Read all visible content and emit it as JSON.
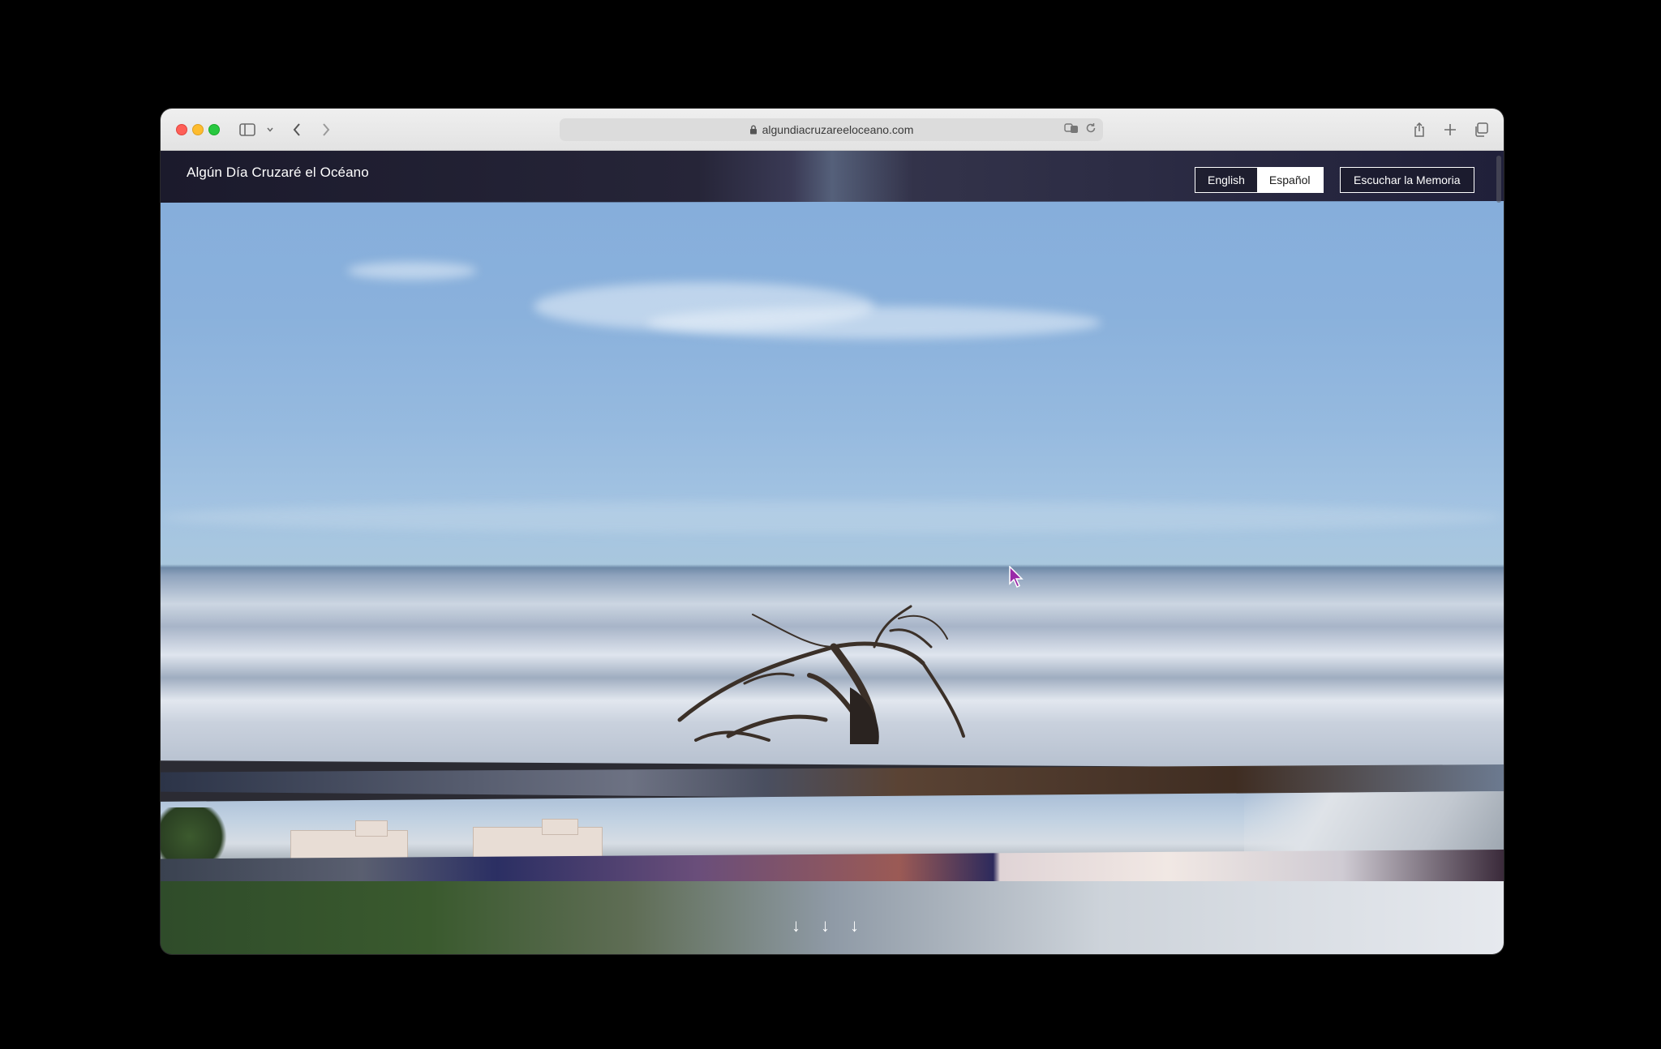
{
  "browser": {
    "url": "algundiacruzareeloceano.com",
    "icons": [
      "sidebar-icon",
      "chevron-down-icon",
      "back-icon",
      "forward-icon",
      "lock-icon",
      "translate-icon",
      "reload-icon",
      "share-icon",
      "plus-icon",
      "tabs-icon"
    ]
  },
  "site": {
    "title": "Algún Día Cruzaré el Océano",
    "languages": [
      {
        "label": "English",
        "active": false
      },
      {
        "label": "Español",
        "active": true
      }
    ],
    "listen_button": "Escuchar la Memoria"
  },
  "scroll_arrows": [
    "↓",
    "↓",
    "↓"
  ],
  "colors": {
    "nav_bg": "#1b1a2c",
    "active_lang_bg": "#ffffff",
    "text": "#ffffff",
    "close": "#fe5f57",
    "minimize": "#febc2e",
    "zoom": "#28c840"
  }
}
